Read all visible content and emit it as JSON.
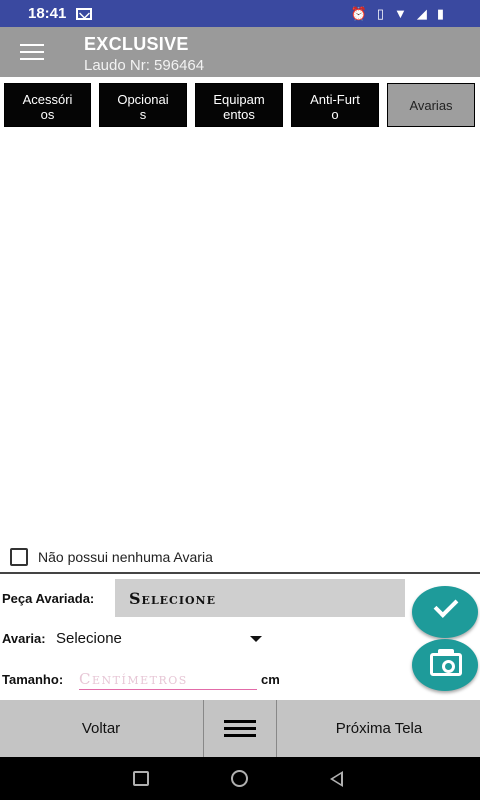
{
  "status_bar": {
    "time": "18:41",
    "icons": [
      "mail-icon",
      "alarm-icon",
      "vibrate-icon",
      "wifi-icon",
      "signal-icon",
      "battery-icon"
    ]
  },
  "app_bar": {
    "title": "EXCLUSIVE",
    "subtitle": "Laudo Nr: 596464"
  },
  "tabs": [
    {
      "line1": "Acessóri",
      "line2": "os",
      "active": false
    },
    {
      "line1": "Opcionai",
      "line2": "s",
      "active": false
    },
    {
      "line1": "Equipam",
      "line2": "entos",
      "active": false
    },
    {
      "line1": "Anti-Furt",
      "line2": "o",
      "active": false
    },
    {
      "line1": "Avarias",
      "line2": "",
      "active": true
    }
  ],
  "form": {
    "no_damage_label": "Não possui nenhuma Avaria",
    "part_label": "Peça Avariada:",
    "part_value": "Selecione",
    "damage_label": "Avaria:",
    "damage_value": "Selecione",
    "size_label": "Tamanho:",
    "size_placeholder": "Centímetros",
    "size_unit": "cm"
  },
  "bottom_bar": {
    "back_label": "Voltar",
    "next_label": "Próxima Tela"
  },
  "colors": {
    "status_bar": "#3a49a0",
    "app_bar": "#9a9a9a",
    "fab": "#1e9b9a",
    "input_underline": "#e26ba8"
  }
}
